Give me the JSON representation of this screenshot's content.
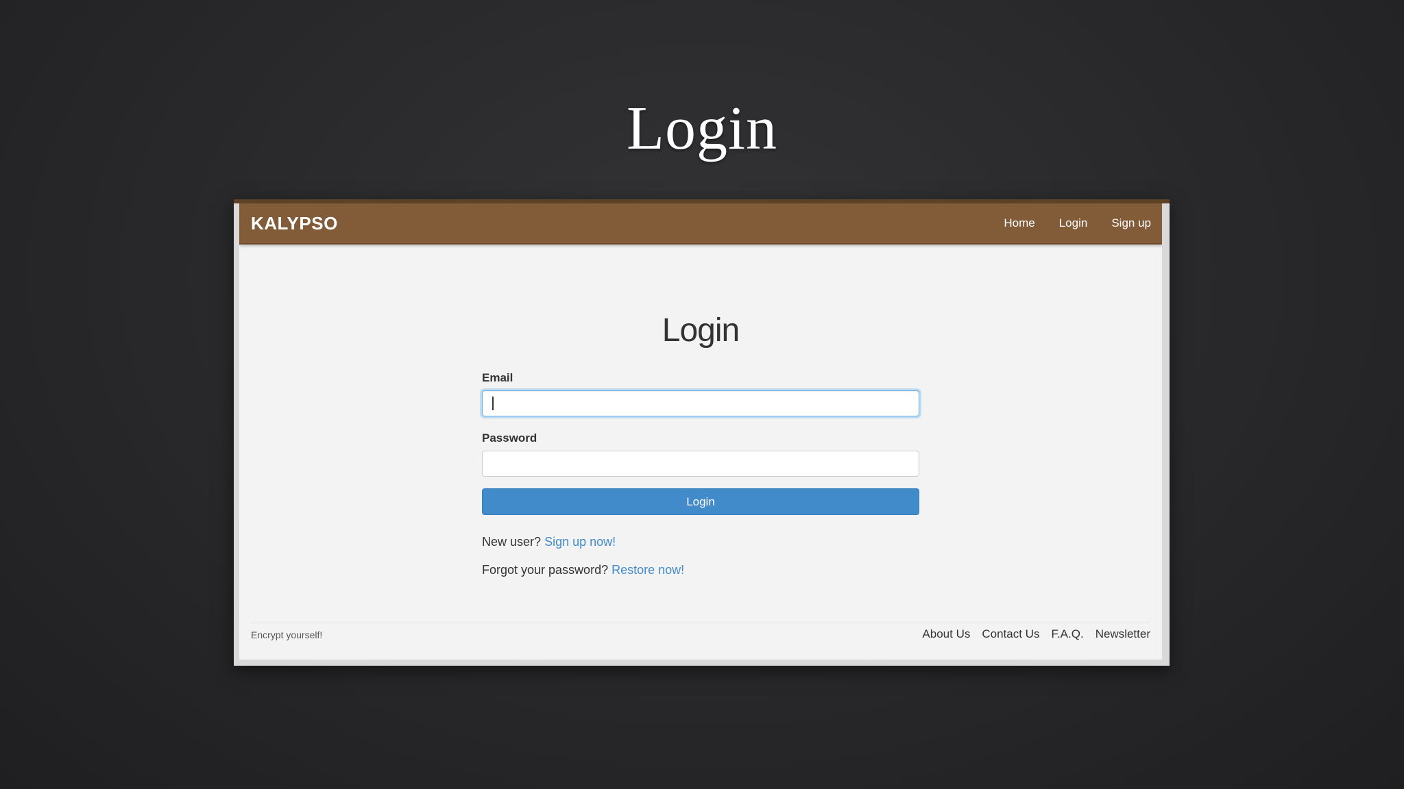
{
  "slide": {
    "title": "Login"
  },
  "navbar": {
    "brand": "KALYPSO",
    "links": [
      "Home",
      "Login",
      "Sign up"
    ]
  },
  "main": {
    "heading": "Login",
    "email_label": "Email",
    "email_value": "",
    "password_label": "Password",
    "password_value": "",
    "login_button": "Login",
    "new_user_text": "New user?",
    "signup_link": "Sign up now!",
    "forgot_text": "Forgot your password?",
    "restore_link": "Restore now!"
  },
  "footer": {
    "tagline": "Encrypt yourself!",
    "links": [
      "About Us",
      "Contact Us",
      "F.A.Q.",
      "Newsletter"
    ]
  },
  "colors": {
    "background": "#2a2a2c",
    "navbar": "#825b38",
    "primary_button": "#428bca",
    "link": "#428bca",
    "content_bg": "#f3f3f3"
  }
}
